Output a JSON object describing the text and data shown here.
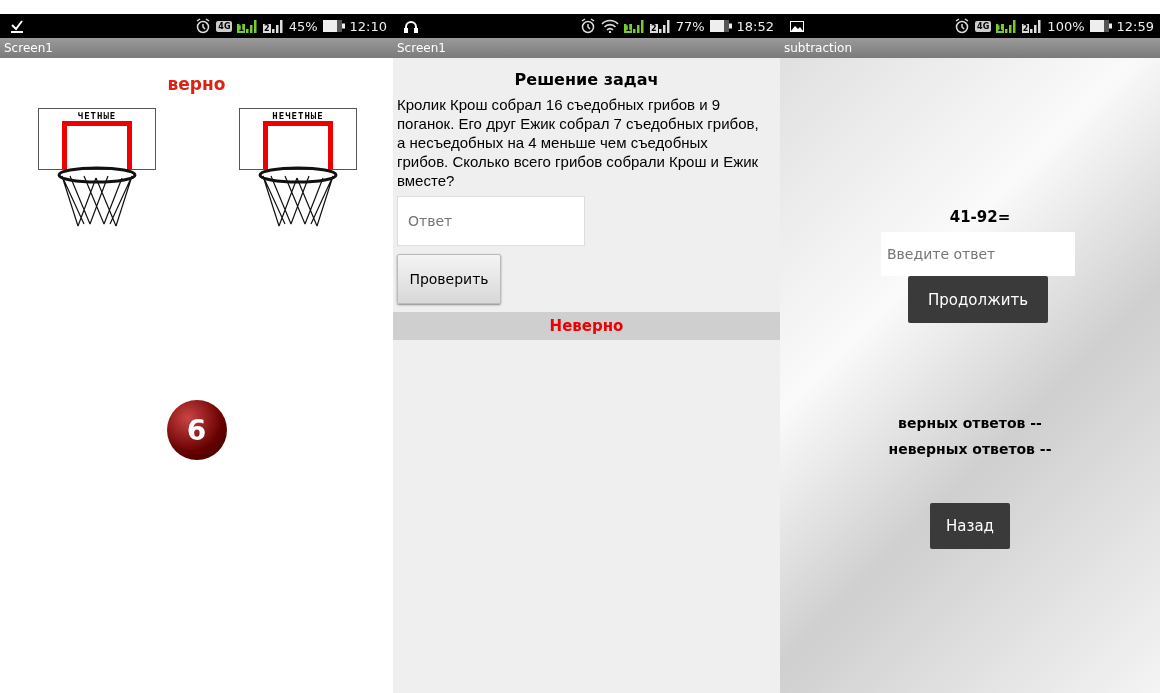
{
  "screens": [
    {
      "status_bar": {
        "notification": {
          "kind": "download"
        },
        "network": {
          "kind": "cellular",
          "label": "4G"
        },
        "sim_1": "1",
        "sim_2": "2",
        "battery": "45%",
        "time": "12:10"
      },
      "title": "Screen1",
      "kind": "hoops",
      "result": "верно",
      "hoops": [
        "ЧЕТНЫЕ",
        "НЕЧЕТНЫЕ"
      ],
      "ball": "6"
    },
    {
      "status_bar": {
        "notification": {
          "kind": "headphones"
        },
        "network": {
          "kind": "wifi"
        },
        "sim_1": "1",
        "sim_2": "2",
        "battery": "77%",
        "time": "18:52"
      },
      "title": "Screen1",
      "kind": "problem",
      "heading": "Решение задач",
      "problem": "Кролик Крош собрал 16 съедобных грибов и 9 поганок. Его друг Ежик собрал 7 съедобных грибов, а несъедобных на 4 меньше чем съедобных грибов. Сколько всего грибов собрали Крош и Ежик вместе?",
      "answer": {
        "placeholder": "Ответ"
      },
      "check_button": "Проверить",
      "result": "Неверно"
    },
    {
      "status_bar": {
        "notification": {
          "kind": "image"
        },
        "network": {
          "kind": "cellular",
          "label": "4G"
        },
        "sim_1": "1",
        "sim_2": "2",
        "battery": "100%",
        "time": "12:59"
      },
      "title": "subtraction",
      "kind": "subtraction",
      "question": "41-92=",
      "answer": {
        "placeholder": "Введите ответ"
      },
      "continue_button": "Продолжить",
      "correct": "верных ответов --",
      "incorrect": "неверных ответов --",
      "back_button": "Назад"
    }
  ]
}
